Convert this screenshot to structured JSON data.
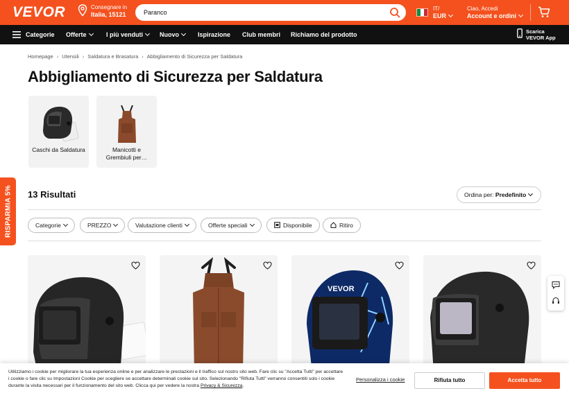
{
  "brand": {
    "logo": "VEVOR",
    "accent": "#f4511e"
  },
  "header": {
    "ship_label": "Consegnare in",
    "ship_location": "Italia, 15121",
    "search_value": "Paranco",
    "lang": "IT/",
    "currency": "EUR",
    "account_greeting": "Ciao, Accedi",
    "account_label": "Account e ordini"
  },
  "nav": {
    "items": [
      "Categorie",
      "Offerte",
      "I più venduti",
      "Nuovo",
      "Ispirazione",
      "Club membri",
      "Richiamo del prodotto"
    ],
    "app_line1": "Scarica",
    "app_line2": "VEVOR App"
  },
  "breadcrumb": [
    "Homepage",
    "Utensili",
    "Saldatura e Brasatura",
    "Abbigliamento di Sicurezza per Saldatura"
  ],
  "page_title": "Abbigliamento di Sicurezza per Saldatura",
  "categories": [
    {
      "label": "Caschi da Saldatura",
      "icon": "welding-helmet"
    },
    {
      "label": "Manicotti e Grembiuli per…",
      "icon": "leather-apron"
    }
  ],
  "results": {
    "count_label": "13 Risultati",
    "sort_prefix": "Ordina per:",
    "sort_value": "Predefinito"
  },
  "filters": [
    "Categorie",
    "PREZZO",
    "Valutazione clienti",
    "Offerte speciali",
    "Disponibile",
    "Ritiro"
  ],
  "products": [
    {
      "image": "black-welding-helmet"
    },
    {
      "image": "brown-leather-welding-apron"
    },
    {
      "image": "blue-lightning-welding-helmet"
    },
    {
      "image": "black-welding-helmet-side"
    }
  ],
  "promo": "RISPARMIA 5%",
  "cookie": {
    "text": "Utilizziamo i cookie per migliorare la tua esperienza online e per analizzare le prestazioni e il traffico sul nostro sito web. Fare clic su \"Accetta Tutti\" per accettare i cookie o fare clic su Impostazioni Cookie per scegliere se accettare determinati cookie sul sito. Selezionando \"Rifiuta Tutti\" verranno consentiti solo i cookie durante la visita necessari per il funzionamento del sito web. Clicca qui per vedere la nostra ",
    "privacy_link": "Privacy & Sicurezza",
    "privacy_suffix": ".",
    "customize": "Personalizza i cookie",
    "reject": "Rifiuta tutto",
    "accept": "Accetta tutto"
  }
}
